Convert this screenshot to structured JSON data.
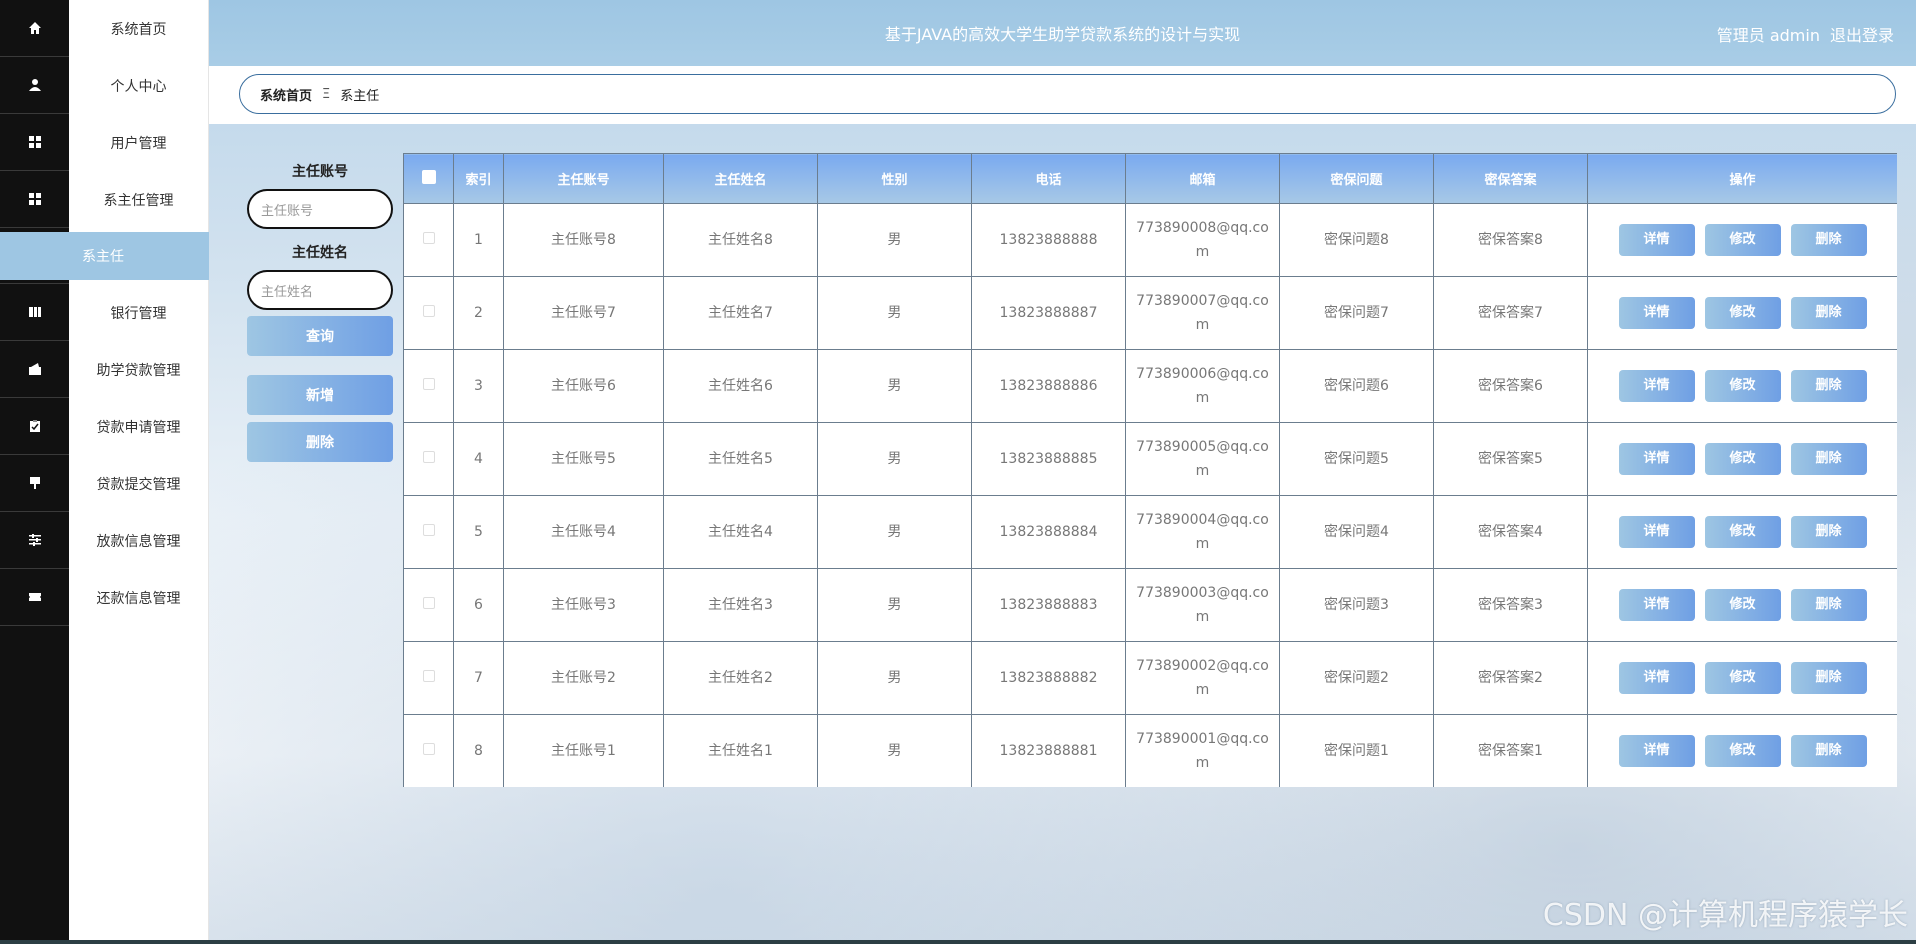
{
  "sidebar": {
    "menu": [
      {
        "label": "系统首页",
        "icon": "home-icon"
      },
      {
        "label": "个人中心",
        "icon": "user-icon"
      },
      {
        "label": "用户管理",
        "icon": "grid-icon"
      },
      {
        "label": "系主任管理",
        "icon": "grid-icon"
      },
      {
        "label": "银行管理",
        "icon": "book-icon"
      },
      {
        "label": "助学贷款管理",
        "icon": "wallet-icon"
      },
      {
        "label": "贷款申请管理",
        "icon": "clipboard-icon"
      },
      {
        "label": "贷款提交管理",
        "icon": "flag-icon"
      },
      {
        "label": "放款信息管理",
        "icon": "sliders-icon"
      },
      {
        "label": "还款信息管理",
        "icon": "ticket-icon"
      }
    ],
    "active_sub": "系主任"
  },
  "header": {
    "title": "基于JAVA的高效大学生助学贷款系统的设计与实现",
    "user": "管理员 admin",
    "logout": "退出登录"
  },
  "breadcrumb": {
    "home": "系统首页",
    "separator": "Ξ",
    "current": "系主任"
  },
  "search": {
    "account_label": "主任账号",
    "account_placeholder": "主任账号",
    "name_label": "主任姓名",
    "name_placeholder": "主任姓名",
    "query_btn": "查询",
    "add_btn": "新增",
    "delete_btn": "删除"
  },
  "table": {
    "columns": [
      "索引",
      "主任账号",
      "主任姓名",
      "性别",
      "电话",
      "邮箱",
      "密保问题",
      "密保答案",
      "操作"
    ],
    "rows": [
      [
        "1",
        "主任账号8",
        "主任姓名8",
        "男",
        "13823888888",
        "773890008@qq.com",
        "密保问题8",
        "密保答案8"
      ],
      [
        "2",
        "主任账号7",
        "主任姓名7",
        "男",
        "13823888887",
        "773890007@qq.com",
        "密保问题7",
        "密保答案7"
      ],
      [
        "3",
        "主任账号6",
        "主任姓名6",
        "男",
        "13823888886",
        "773890006@qq.com",
        "密保问题6",
        "密保答案6"
      ],
      [
        "4",
        "主任账号5",
        "主任姓名5",
        "男",
        "13823888885",
        "773890005@qq.com",
        "密保问题5",
        "密保答案5"
      ],
      [
        "5",
        "主任账号4",
        "主任姓名4",
        "男",
        "13823888884",
        "773890004@qq.com",
        "密保问题4",
        "密保答案4"
      ],
      [
        "6",
        "主任账号3",
        "主任姓名3",
        "男",
        "13823888883",
        "773890003@qq.com",
        "密保问题3",
        "密保答案3"
      ],
      [
        "7",
        "主任账号2",
        "主任姓名2",
        "男",
        "13823888882",
        "773890002@qq.com",
        "密保问题2",
        "密保答案2"
      ],
      [
        "8",
        "主任账号1",
        "主任姓名1",
        "男",
        "13823888881",
        "773890001@qq.com",
        "密保问题1",
        "密保答案1"
      ]
    ],
    "row_actions": [
      "详情",
      "修改",
      "删除"
    ]
  },
  "watermark": "CSDN @计算机程序猿学长",
  "colors": {
    "accent": "#9ec6e3",
    "button_end": "#6f9fe4",
    "sidebar_rail": "#111111"
  }
}
